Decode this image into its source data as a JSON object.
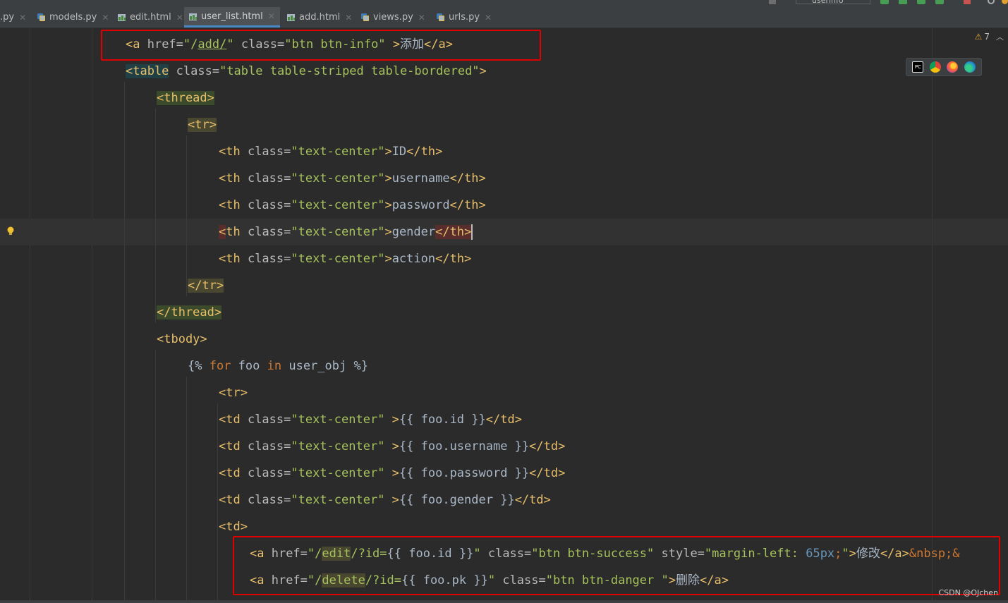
{
  "toolbar": {
    "run_config": "userinfo"
  },
  "tabs": [
    {
      "label": ".py",
      "active": false,
      "icon": "python-file-icon"
    },
    {
      "label": "models.py",
      "active": false,
      "icon": "python-file-icon"
    },
    {
      "label": "edit.html",
      "active": false,
      "icon": "html-file-icon"
    },
    {
      "label": "user_list.html",
      "active": true,
      "icon": "html-file-icon"
    },
    {
      "label": "add.html",
      "active": false,
      "icon": "html-file-icon"
    },
    {
      "label": "views.py",
      "active": false,
      "icon": "python-file-icon"
    },
    {
      "label": "urls.py",
      "active": false,
      "icon": "python-file-icon"
    }
  ],
  "inspection": {
    "warnings": "7"
  },
  "code": {
    "l1": {
      "t1": "<a ",
      "a1": "href=",
      "s1": "\"/",
      "s2": "add/",
      "s3": "\" ",
      "a2": "class=",
      "s4": "\"btn btn-info\" ",
      "t2": ">",
      "x1": "添加",
      "t3": "</a>"
    },
    "l2": {
      "t1": "<table",
      "a1": " class=",
      "s1": "\"table table-striped table-bordered\"",
      "t2": ">"
    },
    "l3": {
      "t1": "<thread>"
    },
    "l4": {
      "t1": "<tr>"
    },
    "l5": {
      "t1": "<th ",
      "a1": "class=",
      "s1": "\"text-center\"",
      "t2": ">",
      "x1": "ID",
      "t3": "</th>"
    },
    "l6": {
      "t1": "<th ",
      "a1": "class=",
      "s1": "\"text-center\"",
      "t2": ">",
      "x1": "username",
      "t3": "</th>"
    },
    "l7": {
      "t1": "<th ",
      "a1": "class=",
      "s1": "\"text-center\"",
      "t2": ">",
      "x1": "password",
      "t3": "</th>"
    },
    "l8": {
      "t0": "<",
      "t1": "th ",
      "a1": "class=",
      "s1": "\"text-center\"",
      "t2": ">",
      "x1": "gender",
      "t3": "</th",
      "t4": ">"
    },
    "l9": {
      "t1": "<th ",
      "a1": "class=",
      "s1": "\"text-center\"",
      "t2": ">",
      "x1": "action",
      "t3": "</th>"
    },
    "l10": {
      "t1": "</tr>"
    },
    "l11": {
      "t1": "</thread>"
    },
    "l12": {
      "t1": "<tbody>"
    },
    "l13": {
      "x1": "{% ",
      "k1": "for",
      "x2": " foo ",
      "k2": "in",
      "x3": " user_obj %}"
    },
    "l14": {
      "t1": "<tr>"
    },
    "l15": {
      "t1": "<td ",
      "a1": "class=",
      "s1": "\"text-center\" ",
      "t2": ">",
      "x1": "{{ foo.id }}",
      "t3": "</td>"
    },
    "l16": {
      "t1": "<td ",
      "a1": "class=",
      "s1": "\"text-center\" ",
      "t2": ">",
      "x1": "{{ foo.username }}",
      "t3": "</td>"
    },
    "l17": {
      "t1": "<td ",
      "a1": "class=",
      "s1": "\"text-center\" ",
      "t2": ">",
      "x1": "{{ foo.password }}",
      "t3": "</td>"
    },
    "l18": {
      "t1": "<td ",
      "a1": "class=",
      "s1": "\"text-center\" ",
      "t2": ">",
      "x1": "{{ foo.gender }}",
      "t3": "</td>"
    },
    "l19": {
      "t1": "<td>"
    },
    "l20": {
      "t1": "<a ",
      "a1": "href=",
      "s1": "\"/",
      "s2": "edit",
      "s3": "/?id=",
      "x1": "{{ foo.id }}",
      "s4": "\" ",
      "a2": "class=",
      "s5": "\"btn btn-success\" ",
      "a3": "style=",
      "s6": "\"margin-left: ",
      "n1": "65px",
      "k1": ";",
      "s7": "\"",
      "t2": ">",
      "x2": "修改",
      "t3": "</a>",
      "k2": "&nbsp;&"
    },
    "l21": {
      "t1": "<a ",
      "a1": "href=",
      "s1": "\"/",
      "s2": "delete",
      "s3": "/?id=",
      "x1": "{{ foo.pk }}",
      "s4": "\" ",
      "a2": "class=",
      "s5": "\"btn btn-danger \"",
      "t2": ">",
      "x2": "删除",
      "t3": "</a>"
    }
  },
  "watermark": "CSDN @OJchen"
}
